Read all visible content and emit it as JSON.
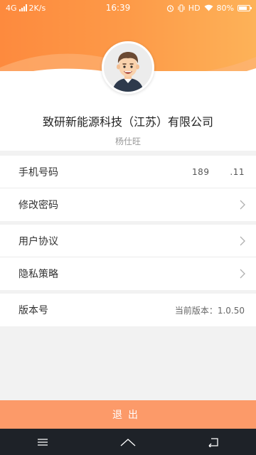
{
  "status_bar": {
    "network": "4G",
    "speed": "2K/s",
    "time": "16:39",
    "hd": "HD",
    "battery": "80%",
    "battery_level": 0.8
  },
  "profile": {
    "company": "致研新能源科技（江苏）有限公司",
    "user_name": "杨仕旺",
    "avatar_icon": "cartoon-avatar"
  },
  "settings": {
    "phone_label": "手机号码",
    "phone_value": "189          .11",
    "password_label": "修改密码",
    "agreement_label": "用户协议",
    "privacy_label": "隐私策略",
    "version_label": "版本号",
    "version_value": "当前版本：1.0.50"
  },
  "logout_label": "退出",
  "colors": {
    "header_start": "#fd8a3e",
    "header_end": "#fdb258",
    "logout_bg": "#fc9a69"
  }
}
